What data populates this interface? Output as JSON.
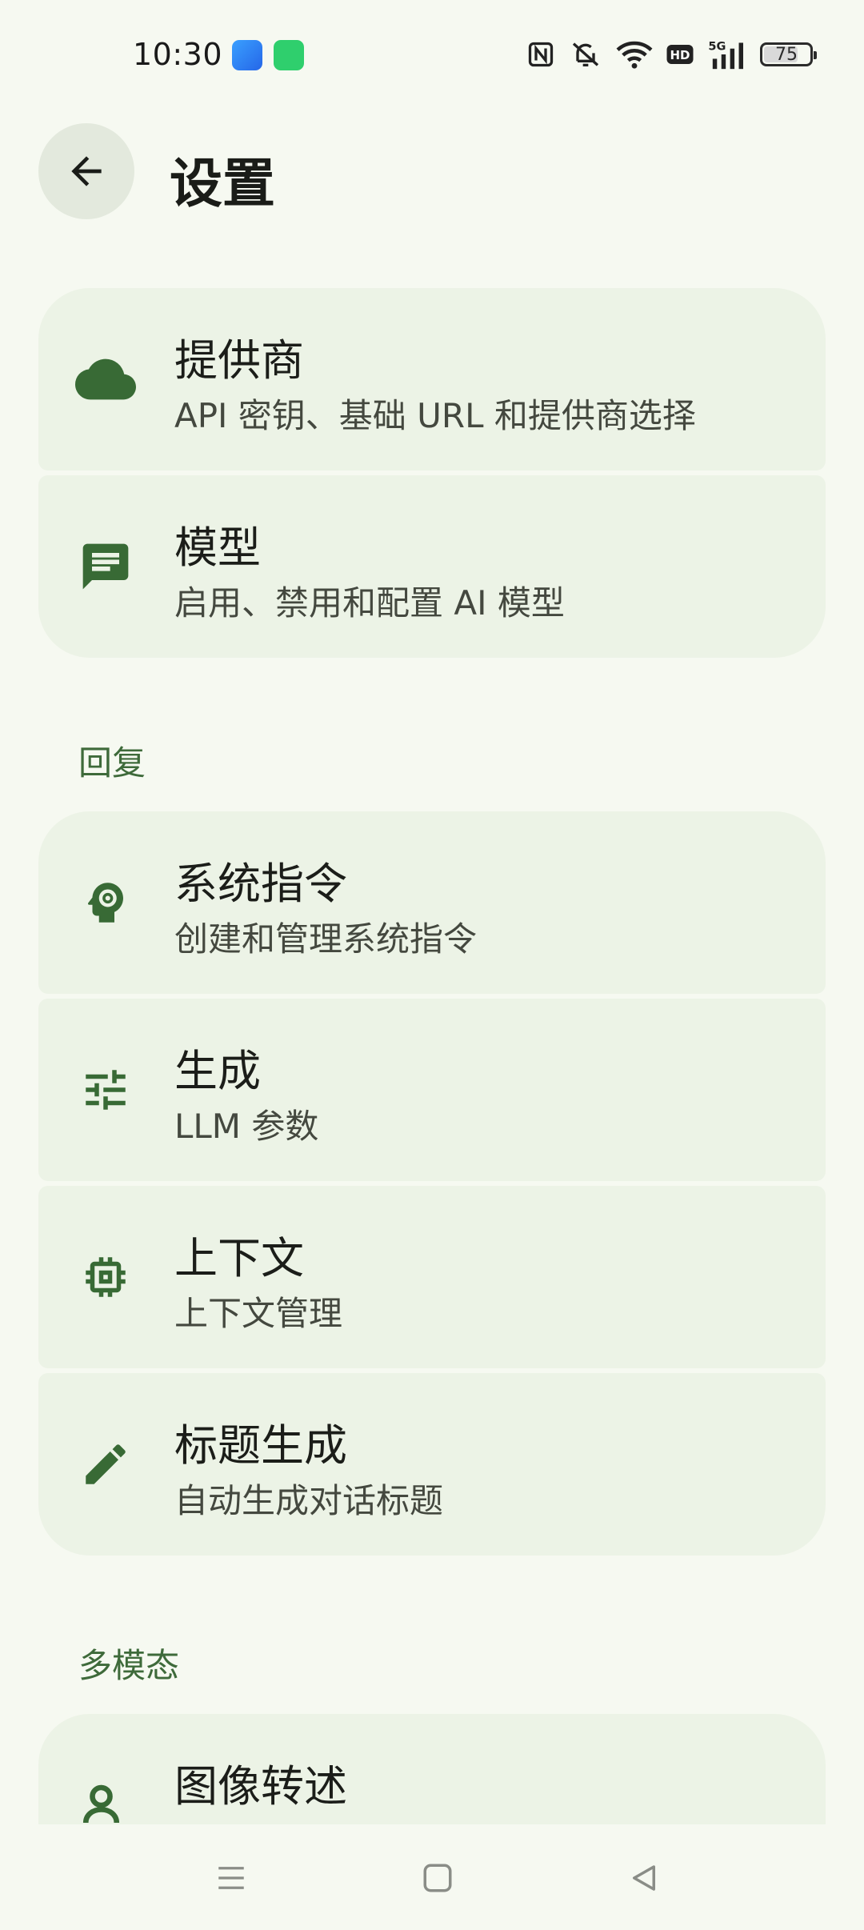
{
  "status_bar": {
    "time": "10:30",
    "battery": "75",
    "network": "5G",
    "hd": "HD"
  },
  "header": {
    "title": "设置",
    "back_icon": "arrow-back-icon"
  },
  "partial_section_header": "",
  "sections": [
    {
      "items": [
        {
          "title": "提供商",
          "subtitle": "API 密钥、基础 URL 和提供商选择",
          "icon": "cloud-icon"
        },
        {
          "title": "模型",
          "subtitle": "启用、禁用和配置 AI 模型",
          "icon": "chat-message-icon"
        }
      ]
    },
    {
      "header": "回复",
      "items": [
        {
          "title": "系统指令",
          "subtitle": "创建和管理系统指令",
          "icon": "head-gear-icon"
        },
        {
          "title": "生成",
          "subtitle": "LLM 参数",
          "icon": "tune-icon"
        },
        {
          "title": "上下文",
          "subtitle": "上下文管理",
          "icon": "chip-icon"
        },
        {
          "title": "标题生成",
          "subtitle": "自动生成对话标题",
          "icon": "pencil-icon"
        }
      ]
    },
    {
      "header": "多模态",
      "items": [
        {
          "title": "图像转述",
          "subtitle": "",
          "icon": "image-person-icon"
        }
      ]
    }
  ],
  "colors": {
    "background": "#f6f9f1",
    "card": "#ecf3e6",
    "accent": "#3e6a3a",
    "icon": "#386a35"
  }
}
